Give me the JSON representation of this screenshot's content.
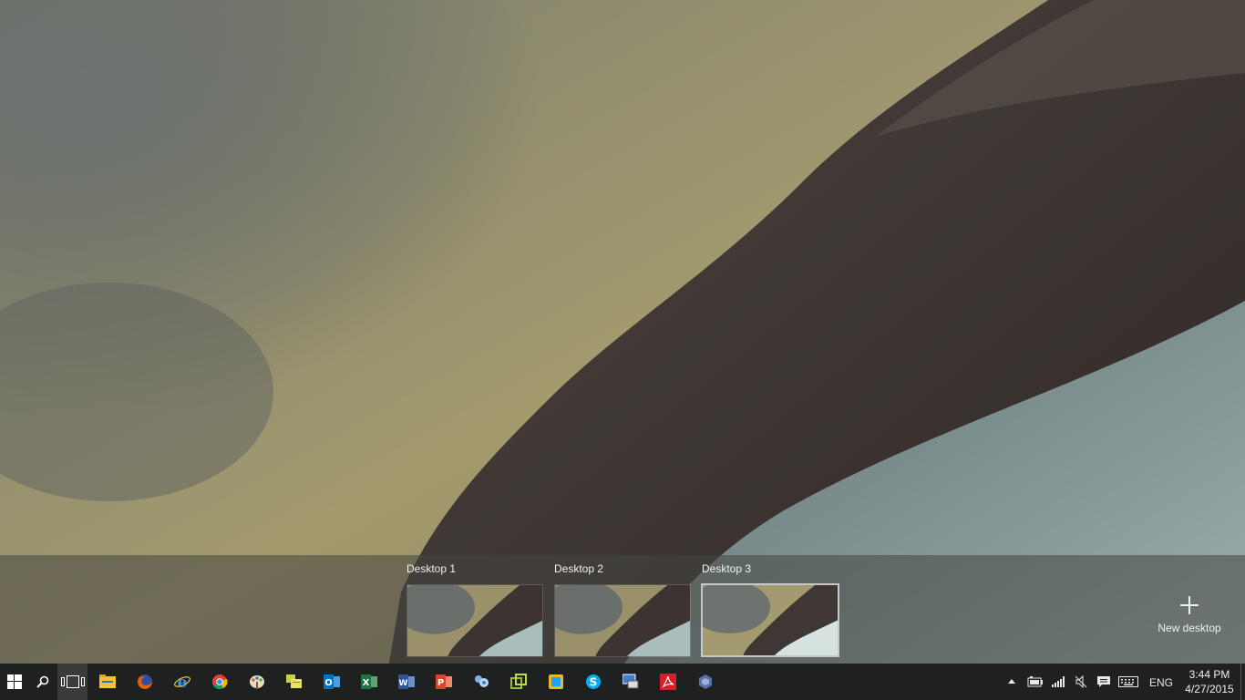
{
  "task_view": {
    "desktops": [
      {
        "label": "Desktop 1",
        "active": false
      },
      {
        "label": "Desktop 2",
        "active": false
      },
      {
        "label": "Desktop 3",
        "active": true
      }
    ],
    "new_desktop_label": "New desktop"
  },
  "taskbar": {
    "start_icon": "windows-logo-icon",
    "search_icon": "search-icon",
    "task_view_icon": "task-view-icon",
    "pinned_apps": [
      {
        "name": "file-explorer-icon",
        "color": "#f3c13a"
      },
      {
        "name": "firefox-icon",
        "color": "#e66000"
      },
      {
        "name": "internet-explorer-icon",
        "color": "#1ea1f1"
      },
      {
        "name": "chrome-icon",
        "color": "#4caf50"
      },
      {
        "name": "paint-icon",
        "color": "#d35b3a"
      },
      {
        "name": "sticky-notes-icon",
        "color": "#c8d04a"
      },
      {
        "name": "outlook-icon",
        "color": "#0072c6"
      },
      {
        "name": "excel-icon",
        "color": "#217346"
      },
      {
        "name": "word-icon",
        "color": "#2b579a"
      },
      {
        "name": "powerpoint-icon",
        "color": "#d24726"
      },
      {
        "name": "settings-app-icon",
        "color": "#7fb3e8"
      },
      {
        "name": "vmware-icon",
        "color": "#8fc23f"
      },
      {
        "name": "virtual-pc-icon",
        "color": "#e8b92a"
      },
      {
        "name": "skype-icon",
        "color": "#00aff0"
      },
      {
        "name": "remote-desktop-icon",
        "color": "#3d7fc9"
      },
      {
        "name": "acrobat-icon",
        "color": "#d5202a"
      },
      {
        "name": "app-icon",
        "color": "#5b6fa8"
      }
    ],
    "tray": {
      "chevron_icon": "chevron-up-icon",
      "battery_icon": "battery-icon",
      "network_icon": "signal-icon",
      "volume_icon": "volume-muted-icon",
      "action_center_icon": "action-center-icon",
      "keyboard_icon": "keyboard-icon",
      "language": "ENG",
      "time": "3:44 PM",
      "date": "4/27/2015"
    }
  }
}
